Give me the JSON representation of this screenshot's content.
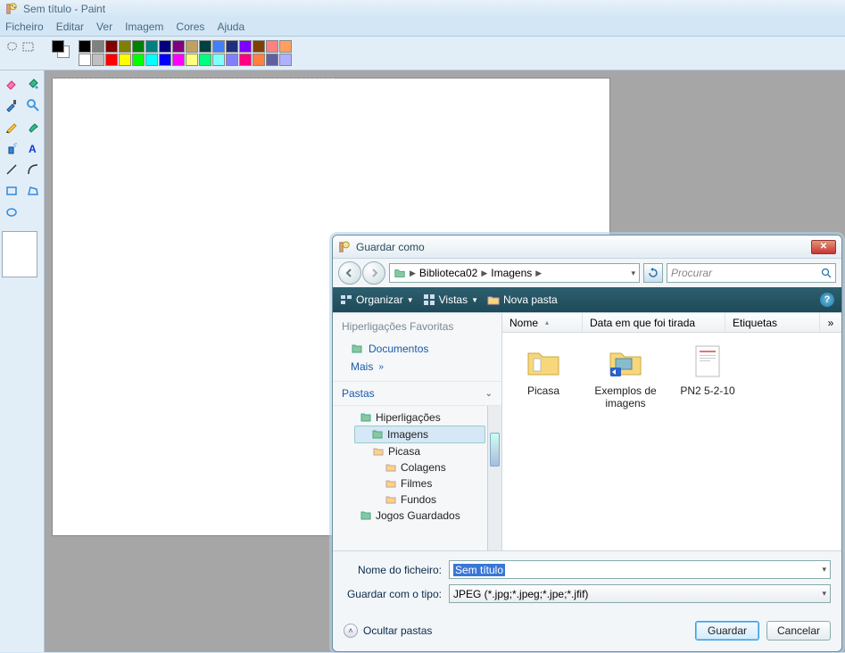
{
  "paint": {
    "title": "Sem título - Paint",
    "menus": {
      "file": "Ficheiro",
      "edit": "Editar",
      "view": "Ver",
      "image": "Imagem",
      "colors": "Cores",
      "help": "Ajuda"
    },
    "palette_row1": [
      "#000000",
      "#808080",
      "#800000",
      "#808000",
      "#008000",
      "#008080",
      "#000080",
      "#800080",
      "#c0a060",
      "#004040",
      "#4080ff",
      "#203080",
      "#8000ff",
      "#804000",
      "#ff8080",
      "#ffa060"
    ],
    "palette_row2": [
      "#ffffff",
      "#c0c0c0",
      "#ff0000",
      "#ffff00",
      "#00ff00",
      "#00ffff",
      "#0000ff",
      "#ff00ff",
      "#ffff80",
      "#00ff80",
      "#80ffff",
      "#8080ff",
      "#ff0080",
      "#ff8040",
      "#6060a0",
      "#b0b0ff"
    ]
  },
  "dialog": {
    "title": "Guardar como",
    "breadcrumb": {
      "root": "Biblioteca02",
      "sub": "Imagens"
    },
    "search_placeholder": "Procurar",
    "cmd": {
      "organize": "Organizar",
      "views": "Vistas",
      "newfolder": "Nova pasta"
    },
    "columns": {
      "name": "Nome",
      "date": "Data em que foi tirada",
      "tags": "Etiquetas"
    },
    "fav_header": "Hiperligações Favoritas",
    "fav": {
      "docs": "Documentos",
      "more": "Mais"
    },
    "folders_label": "Pastas",
    "tree": {
      "hiper": "Hiperligações",
      "imagens": "Imagens",
      "picasa": "Picasa",
      "colagens": "Colagens",
      "filmes": "Filmes",
      "fundos": "Fundos",
      "jogos": "Jogos Guardados"
    },
    "files": {
      "picasa": "Picasa",
      "exemplos": "Exemplos de imagens",
      "pn2": "PN2 5-2-10"
    },
    "form": {
      "name_label": "Nome do ficheiro:",
      "name_value": "Sem título",
      "type_label": "Guardar com o tipo:",
      "type_value": "JPEG (*.jpg;*.jpeg;*.jpe;*.jfif)"
    },
    "hide_folders": "Ocultar pastas",
    "buttons": {
      "save": "Guardar",
      "cancel": "Cancelar"
    }
  }
}
